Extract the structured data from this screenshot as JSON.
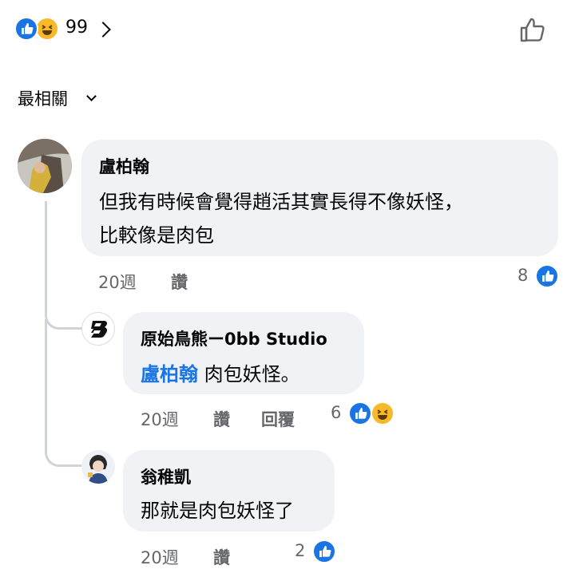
{
  "reactions": {
    "count": "99",
    "icons": [
      "like-icon",
      "haha-icon"
    ],
    "like_color": "#1b74e4",
    "haha_color": "#f7b928"
  },
  "sort": {
    "label": "最相關"
  },
  "comments": [
    {
      "author": "盧柏翰",
      "lines": [
        "但我有時候會覺得趙活其實長得不像妖怪，",
        "比較像是肉包"
      ],
      "time": "20週",
      "like_action": "讚",
      "reaction_count": "8"
    }
  ],
  "replies": [
    {
      "author": "原始鳥熊ー0bb Studio",
      "mention": "盧柏翰",
      "text": "肉包妖怪。",
      "time": "20週",
      "like_action": "讚",
      "reply_action": "回覆",
      "reaction_count": "6"
    },
    {
      "author": "翁稚凱",
      "text": "那就是肉包妖怪了",
      "time": "20週",
      "like_action": "讚",
      "reaction_count": "2"
    }
  ]
}
